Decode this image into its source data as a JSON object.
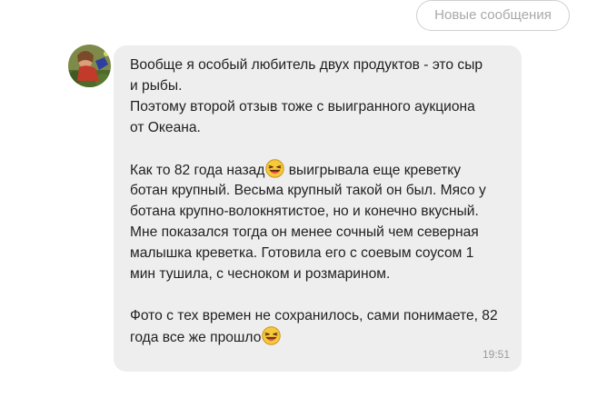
{
  "chat": {
    "new_messages_label": "Новые сообщения",
    "avatar_icon": "user-avatar",
    "message": {
      "lines": [
        "Вообще я особый любитель двух продуктов - это сыр",
        "и рыбы.",
        "Поэтому второй отзыв тоже с выигранного аукциона",
        "от Океана.",
        "",
        "Как то 82 года назад",
        " выигрывала еще креветку",
        "ботан крупный. Весьма крупный такой он был. Мясо у",
        "ботана крупно-волокнятистое, но и конечно вкусный.",
        "Мне показался тогда он менее сочный чем северная",
        "малышка креветка. Готовила его с соевым соусом 1",
        "мин тушила, с чесноком и розмарином.",
        "",
        "Фото с тех времен не сохранилось, сами понимаете, 82",
        "года все же прошло"
      ],
      "emoji": "laughing-face-icon",
      "time": "19:51"
    }
  }
}
